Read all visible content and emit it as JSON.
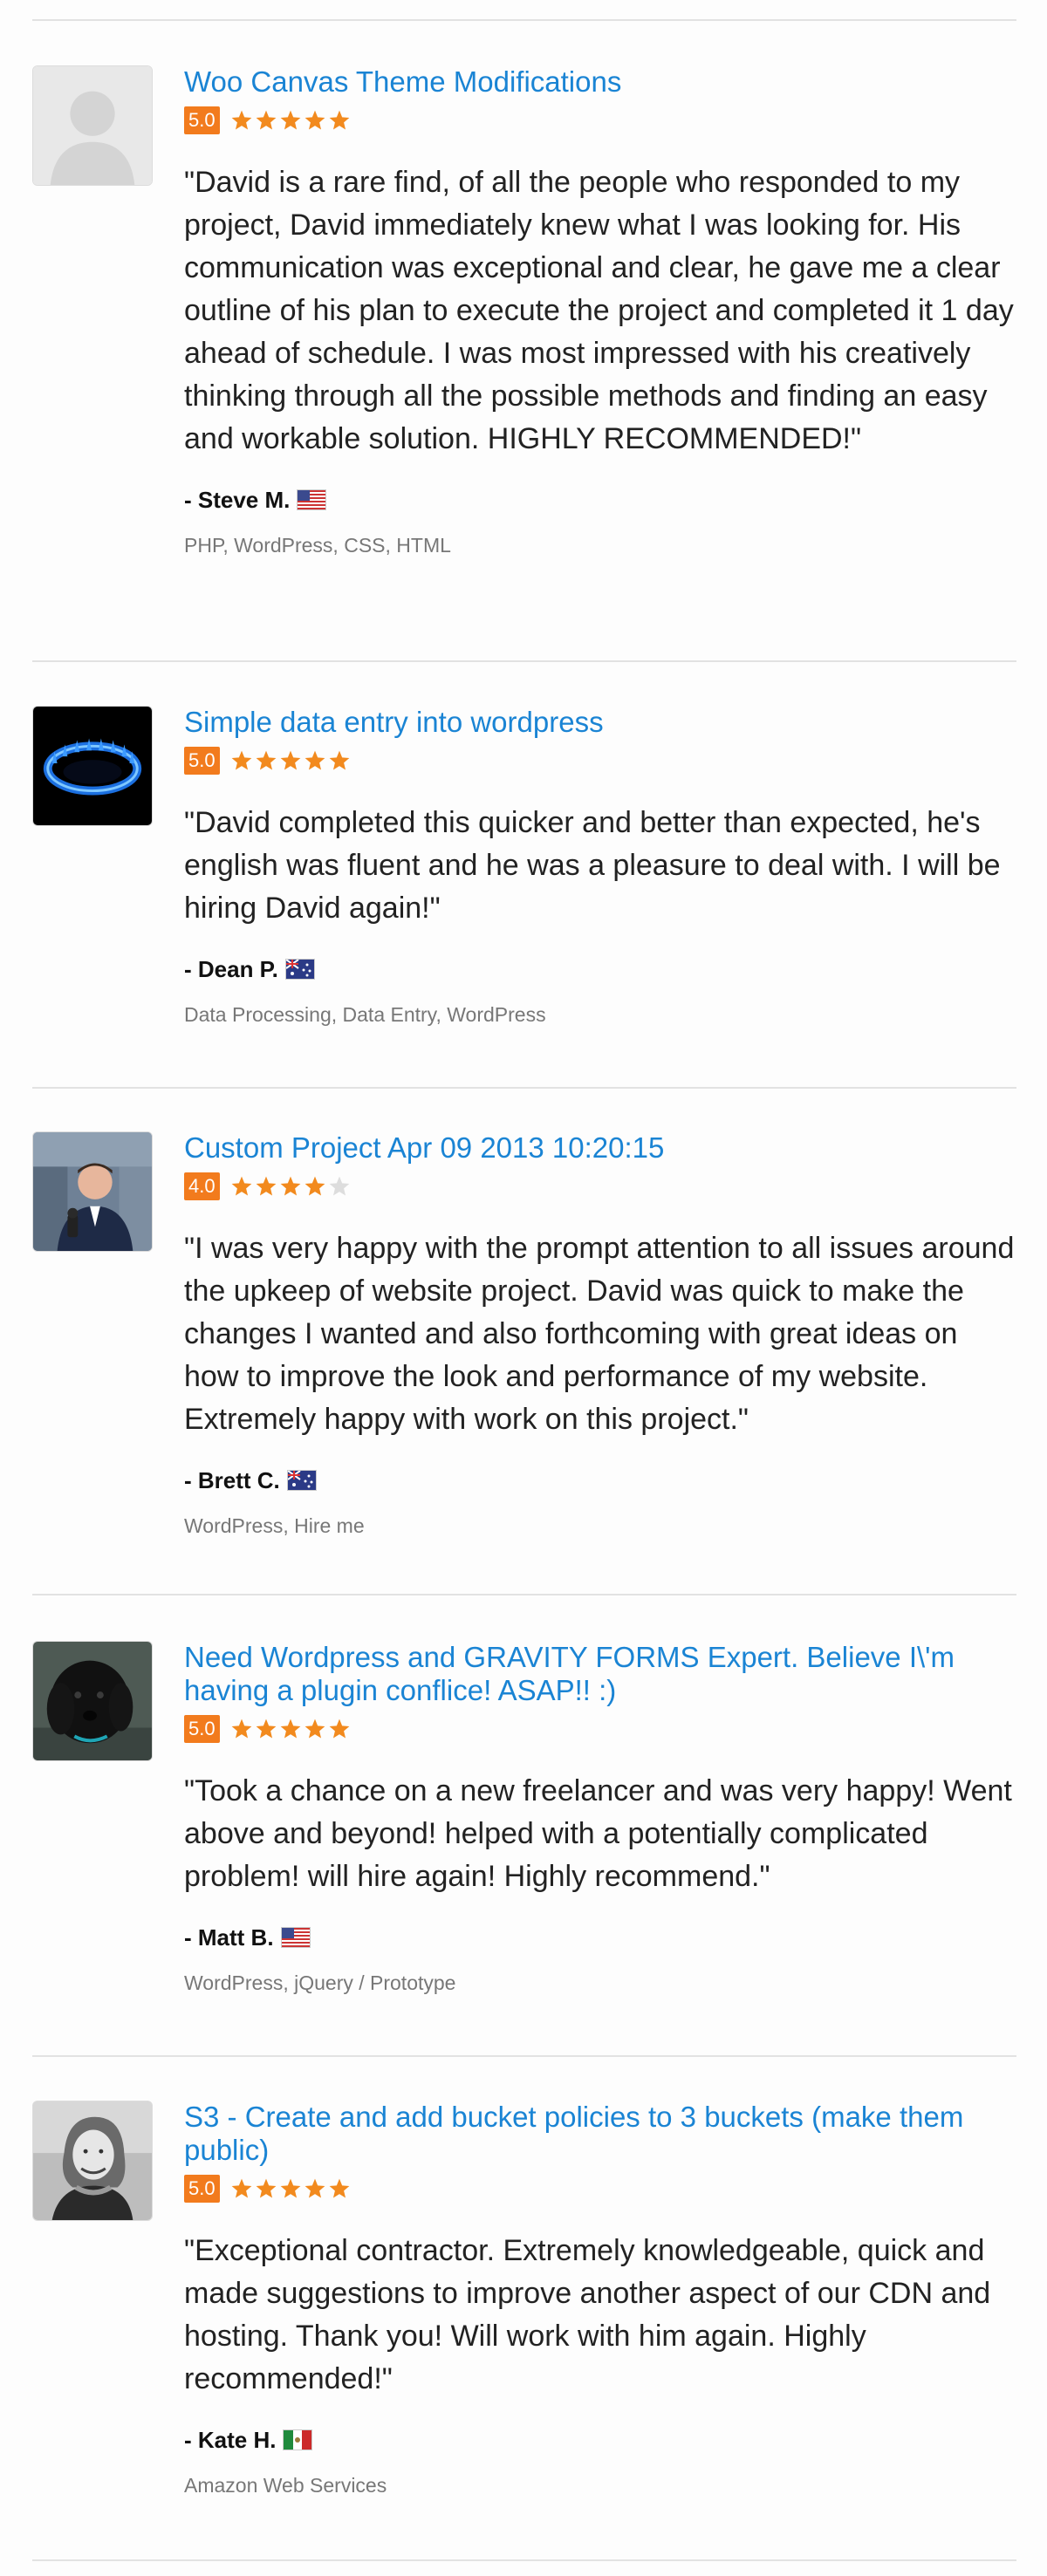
{
  "reviews": [
    {
      "title": "Woo Canvas Theme Modifications",
      "score": "5.0",
      "stars": 5,
      "quote": "\"David is a rare find, of all the people who responded to my project, David immediately knew what I was looking for. His communication was exceptional and clear, he gave me a clear outline of his plan to execute the project and completed it 1 day ahead of schedule. I was most impressed with his creatively thinking through all the possible methods and finding an easy and workable solution. HIGHLY RECOMMENDED!\"",
      "author": "- Steve M.",
      "flag": "us-flag",
      "skills": "PHP, WordPress, CSS, HTML",
      "avatar": "default-avatar"
    },
    {
      "title": "Simple data entry into wordpress",
      "score": "5.0",
      "stars": 5,
      "quote": "\"David completed this quicker and better than expected, he's english was fluent and he was a pleasure to deal with. I will be hiring David again!\"",
      "author": "- Dean P.",
      "flag": "au-flag",
      "skills": "Data Processing, Data Entry, WordPress",
      "avatar": "gas-flame-photo"
    },
    {
      "title": "Custom Project Apr 09 2013 10:20:15",
      "score": "4.0",
      "stars": 4,
      "quote": "\"I was very happy with the prompt attention to all issues around the upkeep of website project. David was quick to make the changes I wanted and also forthcoming with great ideas on how to improve the look and performance of my website. Extremely happy with work on this project.\"",
      "author": "- Brett C.",
      "flag": "au-flag",
      "skills": "WordPress, Hire me",
      "avatar": "reporter-photo"
    },
    {
      "title": "Need Wordpress and GRAVITY FORMS Expert. Believe I\\'m having a plugin conflice! ASAP!! :)",
      "score": "5.0",
      "stars": 5,
      "quote": "\"Took a chance on a new freelancer and was very happy! Went above and beyond! helped with a potentially complicated problem! will hire again! Highly recommend.\"",
      "author": "- Matt B.",
      "flag": "us-flag",
      "skills": "WordPress, jQuery / Prototype",
      "avatar": "black-dog-photo"
    },
    {
      "title": "S3 - Create and add bucket policies to 3 buckets (make them public)",
      "score": "5.0",
      "stars": 5,
      "quote": "\"Exceptional contractor. Extremely knowledgeable, quick and made suggestions to improve another aspect of our CDN and hosting. Thank you! Will work with him again. Highly recommended!\"",
      "author": "- Kate H.",
      "flag": "mx-flag",
      "skills": "Amazon Web Services",
      "avatar": "woman-portrait-photo"
    }
  ],
  "colors": {
    "title": "#1a84d4",
    "score_bg": "#f27b1d",
    "star_filled": "#f28a1e",
    "star_empty": "#dddddd",
    "divider": "#e2e2e2"
  }
}
